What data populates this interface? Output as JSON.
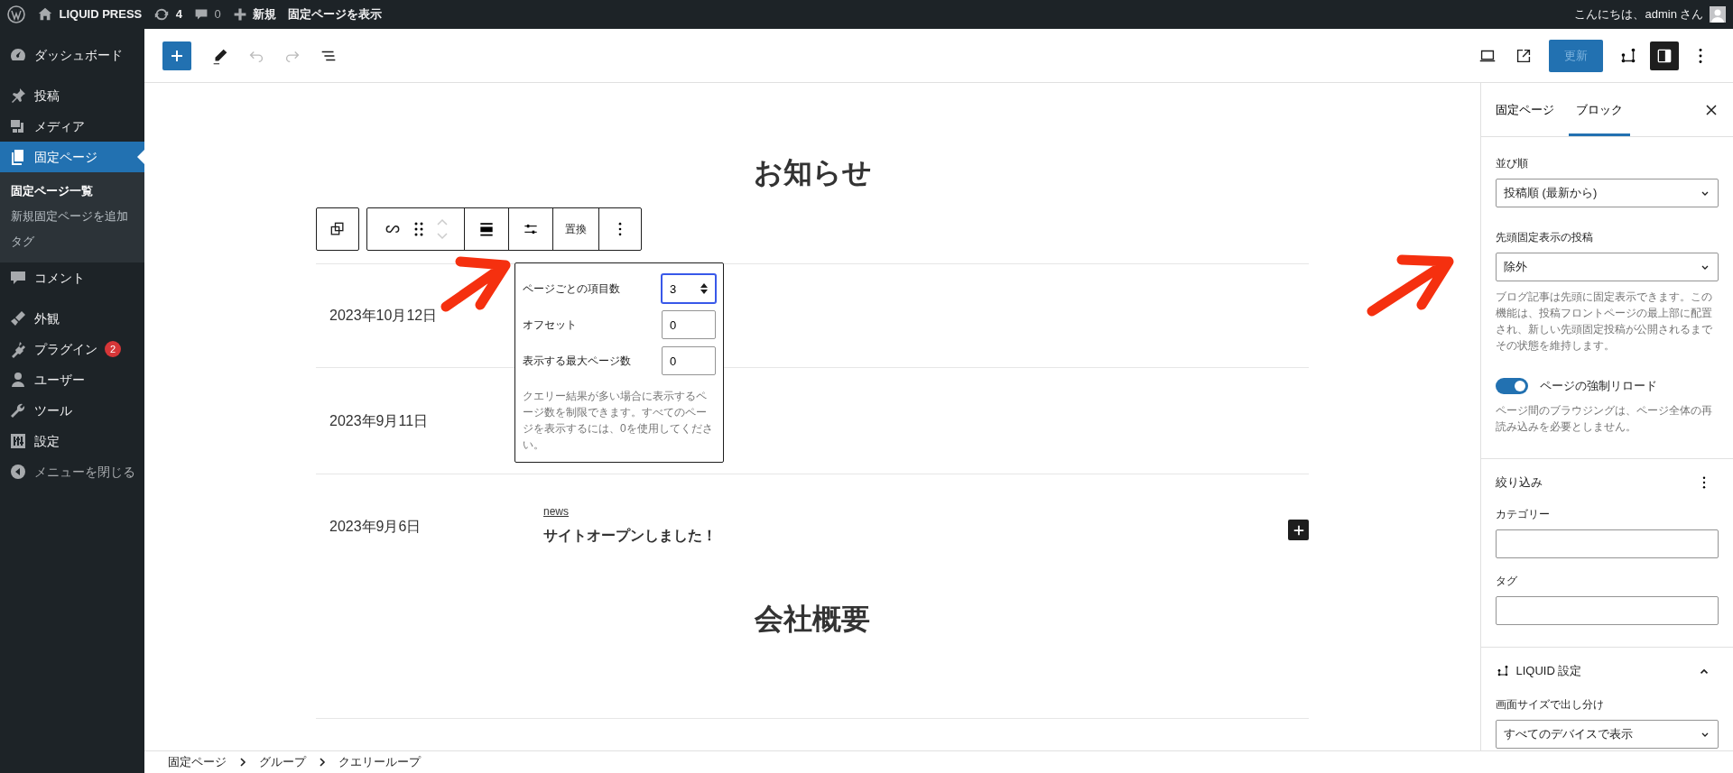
{
  "admin_bar": {
    "site": "LIQUID PRESS",
    "updates": "4",
    "comments": "0",
    "new": "新規",
    "view": "固定ページを表示",
    "greeting": "こんにちは、admin さん"
  },
  "menu": [
    {
      "items": [
        {
          "label": "ダッシュボード",
          "selected": false
        }
      ]
    },
    {
      "items": [
        {
          "label": "投稿",
          "selected": false
        },
        {
          "label": "メディア",
          "selected": false
        },
        {
          "label": "固定ページ",
          "selected": true,
          "children": [
            {
              "label": "固定ページ一覧",
              "selected": true
            },
            {
              "label": "新規固定ページを追加",
              "selected": false
            },
            {
              "label": "タグ",
              "selected": false
            }
          ]
        },
        {
          "label": "コメント",
          "selected": false
        }
      ]
    },
    {
      "items": [
        {
          "label": "外観",
          "selected": false
        },
        {
          "label": "プラグイン",
          "selected": false,
          "badge": "2"
        },
        {
          "label": "ユーザー",
          "selected": false
        },
        {
          "label": "ツール",
          "selected": false
        },
        {
          "label": "設定",
          "selected": false
        },
        {
          "label": "メニューを閉じる",
          "selected": false
        }
      ]
    }
  ],
  "header": {
    "update_button": "更新"
  },
  "canvas": {
    "heading": "お知らせ",
    "block_toolbar": {
      "replace": "置換"
    },
    "posts": [
      {
        "date": "2023年10月12日"
      },
      {
        "date": "2023年9月11日"
      },
      {
        "date": "2023年9月6日",
        "category": "news",
        "title": "サイトオープンしました！"
      }
    ],
    "popover": {
      "fields": [
        {
          "label": "ページごとの項目数",
          "value": "3",
          "focused": true
        },
        {
          "label": "オフセット",
          "value": "0",
          "focused": false
        },
        {
          "label": "表示する最大ページ数",
          "value": "0",
          "focused": false
        }
      ],
      "help": "クエリー結果が多い場合に表示するページ数を制限できます。すべてのページを表示するには、0を使用してください。"
    },
    "heading_2": "会社概要"
  },
  "sidebar": {
    "tabs": [
      {
        "label": "固定ページ",
        "selected": false
      },
      {
        "label": "ブロック",
        "selected": true
      }
    ],
    "order": {
      "label": "並び順",
      "value": "投稿順 (最新から)"
    },
    "sticky": {
      "label": "先頭固定表示の投稿",
      "value": "除外",
      "help": "ブログ記事は先頭に固定表示できます。この機能は、投稿フロントページの最上部に配置され、新しい先頭固定投稿が公開されるまでその状態を維持します。"
    },
    "reload_toggle": {
      "label": "ページの強制リロード",
      "on": true,
      "help": "ページ間のブラウジングは、ページ全体の再読み込みを必要としません。"
    },
    "filters": {
      "title": "絞り込み",
      "fields": [
        {
          "label": "カテゴリー"
        },
        {
          "label": "タグ"
        }
      ]
    },
    "liquid": {
      "title": "LIQUID 設定",
      "expanded": true,
      "field": {
        "label": "画面サイズで出し分け",
        "value": "すべてのデバイスで表示"
      }
    }
  },
  "breadcrumb": [
    "固定ページ",
    "グループ",
    "クエリーループ"
  ]
}
